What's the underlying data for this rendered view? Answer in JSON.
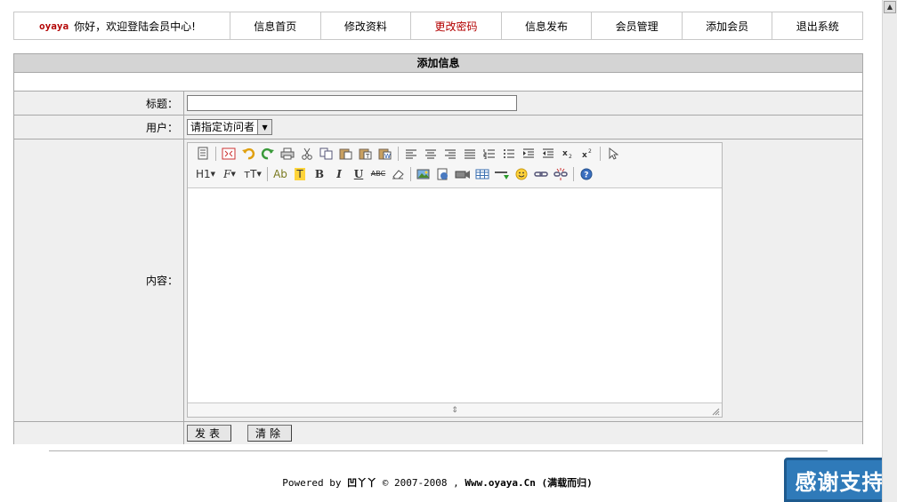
{
  "nav": {
    "brand": "oyaya",
    "welcome": "你好，欢迎登陆会员中心!",
    "items": [
      {
        "label": "信息首页"
      },
      {
        "label": "修改资料"
      },
      {
        "label": "更改密码"
      },
      {
        "label": "信息发布"
      },
      {
        "label": "会员管理"
      },
      {
        "label": "添加会员"
      },
      {
        "label": "退出系统"
      }
    ],
    "active_color": "#b30000"
  },
  "form": {
    "title": "添加信息",
    "title_label": "标题：",
    "title_value": "",
    "user_label": "用户：",
    "user_selected": "请指定访问者",
    "content_label": "内容：",
    "submit_label": "发表",
    "clear_label": "清除"
  },
  "editor": {
    "heading_label": "H1",
    "font_label": "F",
    "size_label": "тT",
    "forecolor_label": "Ab",
    "backcolor_label": "T",
    "bold_label": "B",
    "italic_label": "I",
    "underline_label": "U",
    "strike_label": "ABC"
  },
  "footer": {
    "powered": "Powered by",
    "name": "凹丫丫",
    "copyright": "© 2007-2008 ,",
    "site": "Www.oyaya.Cn",
    "slogan": "(满载而归)"
  },
  "badge": {
    "label": "感谢支持",
    "color": "#2f7ab9"
  }
}
